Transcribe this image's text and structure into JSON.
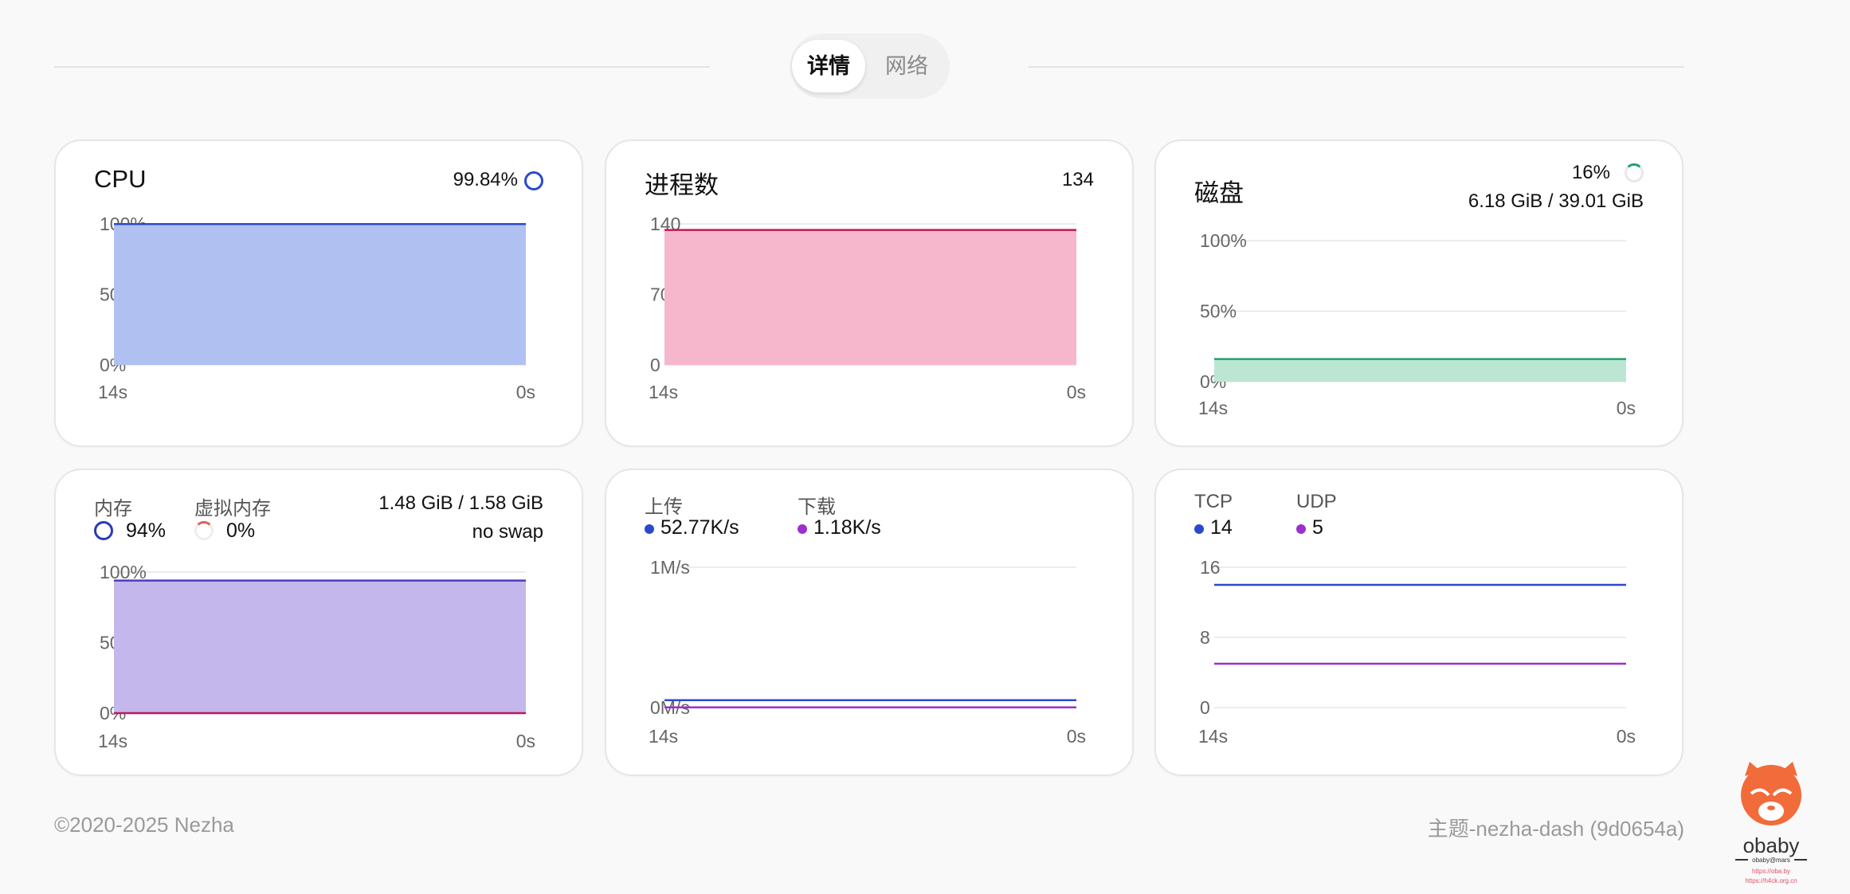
{
  "tabs": [
    {
      "label": "详情"
    },
    {
      "label": "网络"
    }
  ],
  "cards": {
    "cpu": {
      "title": "CPU",
      "percent": "99.84%"
    },
    "process": {
      "title": "进程数",
      "count": "134"
    },
    "disk": {
      "title": "磁盘",
      "percent": "16%",
      "usage": "6.18 GiB / 39.01 GiB"
    },
    "memory": {
      "mem_label": "内存",
      "mem_percent": "94%",
      "swap_label": "虚拟内存",
      "swap_percent": "0%",
      "usage": "1.48 GiB / 1.58 GiB",
      "swap_status": "no swap"
    },
    "network": {
      "upload_label": "上传",
      "upload_value": "52.77K/s",
      "download_label": "下载",
      "download_value": "1.18K/s"
    },
    "connections": {
      "tcp_label": "TCP",
      "tcp_value": "14",
      "udp_label": "UDP",
      "udp_value": "5"
    }
  },
  "chart_data": [
    {
      "id": "cpu",
      "type": "area",
      "x_ticks": [
        "14s",
        "0s"
      ],
      "y_ticks": [
        "100%",
        "50%",
        "0%"
      ],
      "ylim": [
        0,
        100
      ],
      "series": [
        {
          "color": "#2b4acb",
          "fill": "#b0c1f1",
          "values": [
            99.84,
            99.84
          ]
        }
      ]
    },
    {
      "id": "process",
      "type": "area",
      "x_ticks": [
        "14s",
        "0s"
      ],
      "y_ticks": [
        "140",
        "70",
        "0"
      ],
      "ylim": [
        0,
        140
      ],
      "series": [
        {
          "color": "#c2185b",
          "fill": "#f6b7cc",
          "values": [
            134,
            134
          ]
        }
      ]
    },
    {
      "id": "disk",
      "type": "area",
      "x_ticks": [
        "14s",
        "0s"
      ],
      "y_ticks": [
        "100%",
        "50%",
        "0%"
      ],
      "ylim": [
        0,
        100
      ],
      "series": [
        {
          "color": "#22a06b",
          "fill": "#bce6d4",
          "values": [
            16,
            16
          ]
        }
      ]
    },
    {
      "id": "memory",
      "type": "area",
      "x_ticks": [
        "14s",
        "0s"
      ],
      "y_ticks": [
        "100%",
        "50%",
        "0%"
      ],
      "ylim": [
        0,
        100
      ],
      "series": [
        {
          "color": "#4a3cc1",
          "fill": "#c4b7eb",
          "values": [
            94,
            94
          ]
        },
        {
          "color": "#c2185b",
          "fill": "none",
          "values": [
            0,
            0
          ]
        }
      ]
    },
    {
      "id": "network",
      "type": "line",
      "x_ticks": [
        "14s",
        "0s"
      ],
      "y_ticks": [
        "1M/s",
        "0M/s"
      ],
      "ylim": [
        0,
        1
      ],
      "series": [
        {
          "color": "#2b4acb",
          "values": [
            0.05277,
            0.05277
          ]
        },
        {
          "color": "#9c2fcf",
          "values": [
            0.00118,
            0.00118
          ]
        }
      ]
    },
    {
      "id": "connections",
      "type": "line",
      "x_ticks": [
        "14s",
        "0s"
      ],
      "y_ticks": [
        "16",
        "8",
        "0"
      ],
      "ylim": [
        0,
        16
      ],
      "series": [
        {
          "color": "#2b4acb",
          "values": [
            14,
            14
          ]
        },
        {
          "color": "#9c2fcf",
          "values": [
            5,
            5
          ]
        }
      ]
    }
  ],
  "footer": {
    "copyright": "©2020-2025 Nezha",
    "theme": "主题-nezha-dash (9d0654a)"
  },
  "logo": {
    "text": "obaby",
    "subtitle": "obaby@mars",
    "url1": "https://oba.by",
    "url2": "https://h4ck.org.cn"
  },
  "colors": {
    "blue": "#2b4acb",
    "purple": "#9c2fcf",
    "pink": "#c2185b",
    "green": "#22a06b"
  }
}
